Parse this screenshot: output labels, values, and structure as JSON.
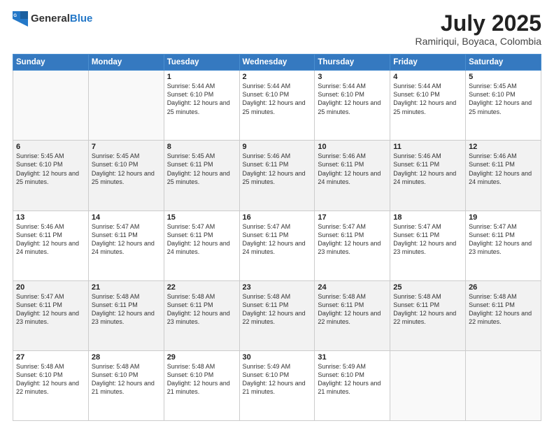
{
  "logo": {
    "general": "General",
    "blue": "Blue"
  },
  "title": {
    "month_year": "July 2025",
    "location": "Ramiriqui, Boyaca, Colombia"
  },
  "weekdays": [
    "Sunday",
    "Monday",
    "Tuesday",
    "Wednesday",
    "Thursday",
    "Friday",
    "Saturday"
  ],
  "weeks": [
    [
      {
        "day": "",
        "info": ""
      },
      {
        "day": "",
        "info": ""
      },
      {
        "day": "1",
        "info": "Sunrise: 5:44 AM\nSunset: 6:10 PM\nDaylight: 12 hours and 25 minutes."
      },
      {
        "day": "2",
        "info": "Sunrise: 5:44 AM\nSunset: 6:10 PM\nDaylight: 12 hours and 25 minutes."
      },
      {
        "day": "3",
        "info": "Sunrise: 5:44 AM\nSunset: 6:10 PM\nDaylight: 12 hours and 25 minutes."
      },
      {
        "day": "4",
        "info": "Sunrise: 5:44 AM\nSunset: 6:10 PM\nDaylight: 12 hours and 25 minutes."
      },
      {
        "day": "5",
        "info": "Sunrise: 5:45 AM\nSunset: 6:10 PM\nDaylight: 12 hours and 25 minutes."
      }
    ],
    [
      {
        "day": "6",
        "info": "Sunrise: 5:45 AM\nSunset: 6:10 PM\nDaylight: 12 hours and 25 minutes."
      },
      {
        "day": "7",
        "info": "Sunrise: 5:45 AM\nSunset: 6:10 PM\nDaylight: 12 hours and 25 minutes."
      },
      {
        "day": "8",
        "info": "Sunrise: 5:45 AM\nSunset: 6:11 PM\nDaylight: 12 hours and 25 minutes."
      },
      {
        "day": "9",
        "info": "Sunrise: 5:46 AM\nSunset: 6:11 PM\nDaylight: 12 hours and 25 minutes."
      },
      {
        "day": "10",
        "info": "Sunrise: 5:46 AM\nSunset: 6:11 PM\nDaylight: 12 hours and 24 minutes."
      },
      {
        "day": "11",
        "info": "Sunrise: 5:46 AM\nSunset: 6:11 PM\nDaylight: 12 hours and 24 minutes."
      },
      {
        "day": "12",
        "info": "Sunrise: 5:46 AM\nSunset: 6:11 PM\nDaylight: 12 hours and 24 minutes."
      }
    ],
    [
      {
        "day": "13",
        "info": "Sunrise: 5:46 AM\nSunset: 6:11 PM\nDaylight: 12 hours and 24 minutes."
      },
      {
        "day": "14",
        "info": "Sunrise: 5:47 AM\nSunset: 6:11 PM\nDaylight: 12 hours and 24 minutes."
      },
      {
        "day": "15",
        "info": "Sunrise: 5:47 AM\nSunset: 6:11 PM\nDaylight: 12 hours and 24 minutes."
      },
      {
        "day": "16",
        "info": "Sunrise: 5:47 AM\nSunset: 6:11 PM\nDaylight: 12 hours and 24 minutes."
      },
      {
        "day": "17",
        "info": "Sunrise: 5:47 AM\nSunset: 6:11 PM\nDaylight: 12 hours and 23 minutes."
      },
      {
        "day": "18",
        "info": "Sunrise: 5:47 AM\nSunset: 6:11 PM\nDaylight: 12 hours and 23 minutes."
      },
      {
        "day": "19",
        "info": "Sunrise: 5:47 AM\nSunset: 6:11 PM\nDaylight: 12 hours and 23 minutes."
      }
    ],
    [
      {
        "day": "20",
        "info": "Sunrise: 5:47 AM\nSunset: 6:11 PM\nDaylight: 12 hours and 23 minutes."
      },
      {
        "day": "21",
        "info": "Sunrise: 5:48 AM\nSunset: 6:11 PM\nDaylight: 12 hours and 23 minutes."
      },
      {
        "day": "22",
        "info": "Sunrise: 5:48 AM\nSunset: 6:11 PM\nDaylight: 12 hours and 23 minutes."
      },
      {
        "day": "23",
        "info": "Sunrise: 5:48 AM\nSunset: 6:11 PM\nDaylight: 12 hours and 22 minutes."
      },
      {
        "day": "24",
        "info": "Sunrise: 5:48 AM\nSunset: 6:11 PM\nDaylight: 12 hours and 22 minutes."
      },
      {
        "day": "25",
        "info": "Sunrise: 5:48 AM\nSunset: 6:11 PM\nDaylight: 12 hours and 22 minutes."
      },
      {
        "day": "26",
        "info": "Sunrise: 5:48 AM\nSunset: 6:11 PM\nDaylight: 12 hours and 22 minutes."
      }
    ],
    [
      {
        "day": "27",
        "info": "Sunrise: 5:48 AM\nSunset: 6:10 PM\nDaylight: 12 hours and 22 minutes."
      },
      {
        "day": "28",
        "info": "Sunrise: 5:48 AM\nSunset: 6:10 PM\nDaylight: 12 hours and 21 minutes."
      },
      {
        "day": "29",
        "info": "Sunrise: 5:48 AM\nSunset: 6:10 PM\nDaylight: 12 hours and 21 minutes."
      },
      {
        "day": "30",
        "info": "Sunrise: 5:49 AM\nSunset: 6:10 PM\nDaylight: 12 hours and 21 minutes."
      },
      {
        "day": "31",
        "info": "Sunrise: 5:49 AM\nSunset: 6:10 PM\nDaylight: 12 hours and 21 minutes."
      },
      {
        "day": "",
        "info": ""
      },
      {
        "day": "",
        "info": ""
      }
    ]
  ]
}
